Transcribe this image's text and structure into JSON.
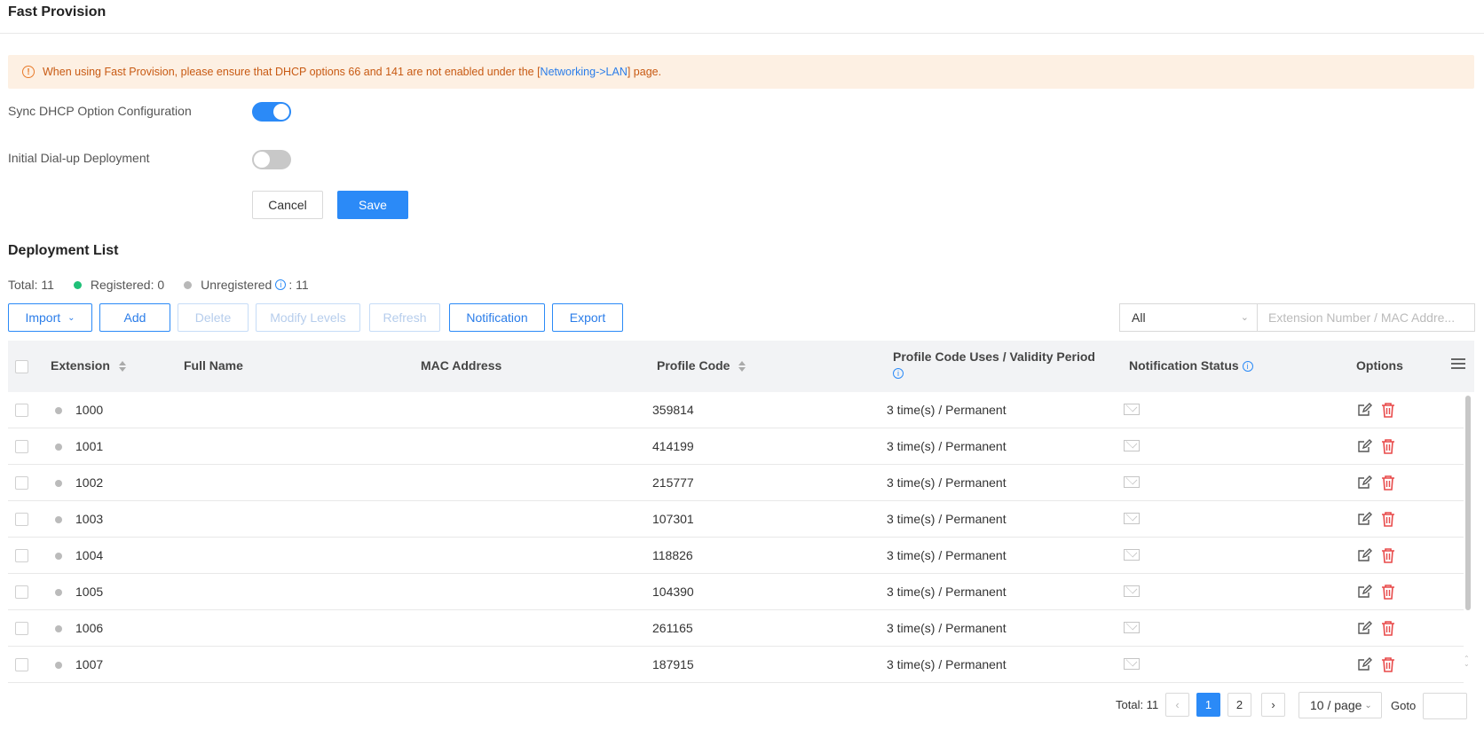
{
  "header": {
    "title": "Fast Provision"
  },
  "alert": {
    "text_before": "When using Fast Provision, please ensure that DHCP options 66 and 141 are not enabled under the [",
    "link_text": "Networking->LAN",
    "text_after": "] page."
  },
  "settings": {
    "sync_dhcp_label": "Sync DHCP Option Configuration",
    "sync_dhcp_enabled": true,
    "initial_dialup_label": "Initial Dial-up Deployment",
    "initial_dialup_enabled": false,
    "cancel_label": "Cancel",
    "save_label": "Save"
  },
  "deployment": {
    "title": "Deployment List",
    "total_label": "Total: 11",
    "registered_label": "Registered: 0",
    "unregistered_label": "Unregistered",
    "unregistered_count": ": 11",
    "registered_color": "#1fc078",
    "unregistered_color": "#b8b8b8"
  },
  "toolbar": {
    "import_label": "Import",
    "add_label": "Add",
    "delete_label": "Delete",
    "modify_levels_label": "Modify Levels",
    "refresh_label": "Refresh",
    "notification_label": "Notification",
    "export_label": "Export",
    "filter_value": "All",
    "search_placeholder": "Extension Number / MAC Addre..."
  },
  "table": {
    "headers": {
      "extension": "Extension",
      "full_name": "Full Name",
      "mac_address": "MAC Address",
      "profile_code": "Profile Code",
      "profile_uses": "Profile Code Uses / Validity Period",
      "notification_status": "Notification Status",
      "options": "Options"
    },
    "rows": [
      {
        "extension": "1000",
        "full_name": "",
        "mac": "",
        "profile_code": "359814",
        "uses": "3 time(s) / Permanent"
      },
      {
        "extension": "1001",
        "full_name": "",
        "mac": "",
        "profile_code": "414199",
        "uses": "3 time(s) / Permanent"
      },
      {
        "extension": "1002",
        "full_name": "",
        "mac": "",
        "profile_code": "215777",
        "uses": "3 time(s) / Permanent"
      },
      {
        "extension": "1003",
        "full_name": "",
        "mac": "",
        "profile_code": "107301",
        "uses": "3 time(s) / Permanent"
      },
      {
        "extension": "1004",
        "full_name": "",
        "mac": "",
        "profile_code": "118826",
        "uses": "3 time(s) / Permanent"
      },
      {
        "extension": "1005",
        "full_name": "",
        "mac": "",
        "profile_code": "104390",
        "uses": "3 time(s) / Permanent"
      },
      {
        "extension": "1006",
        "full_name": "",
        "mac": "",
        "profile_code": "261165",
        "uses": "3 time(s) / Permanent"
      },
      {
        "extension": "1007",
        "full_name": "",
        "mac": "",
        "profile_code": "187915",
        "uses": "3 time(s) / Permanent"
      }
    ]
  },
  "pagination": {
    "total_label": "Total: 11",
    "pages": [
      "1",
      "2"
    ],
    "current_page": "1",
    "page_size_label": "10 / page",
    "goto_label": "Goto"
  }
}
